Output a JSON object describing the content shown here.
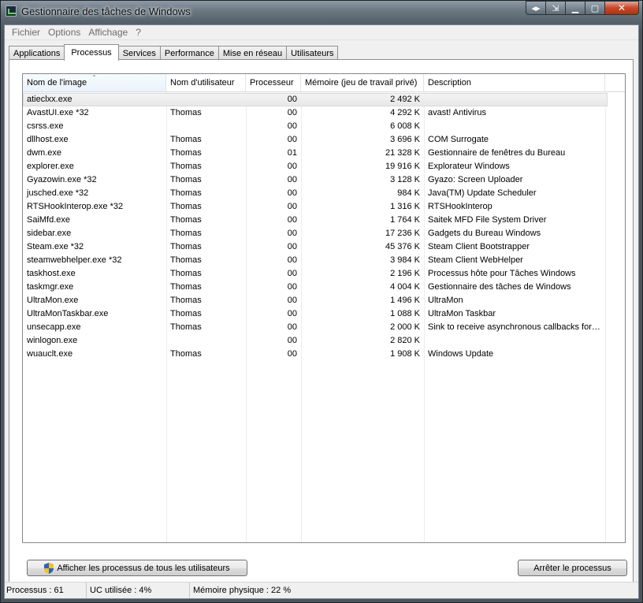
{
  "window": {
    "title": "Gestionnaire des tâches de Windows"
  },
  "menu": [
    "Fichier",
    "Options",
    "Affichage",
    "?"
  ],
  "tabs": [
    {
      "label": "Applications",
      "active": false
    },
    {
      "label": "Processus",
      "active": true
    },
    {
      "label": "Services",
      "active": false
    },
    {
      "label": "Performance",
      "active": false
    },
    {
      "label": "Mise en réseau",
      "active": false
    },
    {
      "label": "Utilisateurs",
      "active": false
    }
  ],
  "columns": [
    "Nom de l'image",
    "Nom d'utilisateur",
    "Processeur",
    "Mémoire (jeu de travail privé)",
    "Description"
  ],
  "processes": [
    {
      "name": "atieclxx.exe",
      "user": "",
      "cpu": "00",
      "mem": "2 492 K",
      "desc": ""
    },
    {
      "name": "AvastUI.exe *32",
      "user": "Thomas",
      "cpu": "00",
      "mem": "4 292 K",
      "desc": "avast! Antivirus"
    },
    {
      "name": "csrss.exe",
      "user": "",
      "cpu": "00",
      "mem": "6 008 K",
      "desc": ""
    },
    {
      "name": "dllhost.exe",
      "user": "Thomas",
      "cpu": "00",
      "mem": "3 696 K",
      "desc": "COM Surrogate"
    },
    {
      "name": "dwm.exe",
      "user": "Thomas",
      "cpu": "01",
      "mem": "21 328 K",
      "desc": "Gestionnaire de fenêtres du Bureau"
    },
    {
      "name": "explorer.exe",
      "user": "Thomas",
      "cpu": "00",
      "mem": "19 916 K",
      "desc": "Explorateur Windows"
    },
    {
      "name": "Gyazowin.exe *32",
      "user": "Thomas",
      "cpu": "00",
      "mem": "3 128 K",
      "desc": "Gyazo: Screen Uploader"
    },
    {
      "name": "jusched.exe *32",
      "user": "Thomas",
      "cpu": "00",
      "mem": "984 K",
      "desc": "Java(TM) Update Scheduler"
    },
    {
      "name": "RTSHookInterop.exe *32",
      "user": "Thomas",
      "cpu": "00",
      "mem": "1 316 K",
      "desc": "RTSHookInterop"
    },
    {
      "name": "SaiMfd.exe",
      "user": "Thomas",
      "cpu": "00",
      "mem": "1 764 K",
      "desc": "Saitek MFD File System Driver"
    },
    {
      "name": "sidebar.exe",
      "user": "Thomas",
      "cpu": "00",
      "mem": "17 236 K",
      "desc": "Gadgets du Bureau Windows"
    },
    {
      "name": "Steam.exe *32",
      "user": "Thomas",
      "cpu": "00",
      "mem": "45 376 K",
      "desc": "Steam Client Bootstrapper"
    },
    {
      "name": "steamwebhelper.exe *32",
      "user": "Thomas",
      "cpu": "00",
      "mem": "3 984 K",
      "desc": "Steam Client WebHelper"
    },
    {
      "name": "taskhost.exe",
      "user": "Thomas",
      "cpu": "00",
      "mem": "2 196 K",
      "desc": "Processus hôte pour Tâches Windows"
    },
    {
      "name": "taskmgr.exe",
      "user": "Thomas",
      "cpu": "00",
      "mem": "4 004 K",
      "desc": "Gestionnaire des tâches de Windows"
    },
    {
      "name": "UltraMon.exe",
      "user": "Thomas",
      "cpu": "00",
      "mem": "1 496 K",
      "desc": "UltraMon"
    },
    {
      "name": "UltraMonTaskbar.exe",
      "user": "Thomas",
      "cpu": "00",
      "mem": "1 088 K",
      "desc": "UltraMon Taskbar"
    },
    {
      "name": "unsecapp.exe",
      "user": "Thomas",
      "cpu": "00",
      "mem": "2 000 K",
      "desc": "Sink to receive asynchronous callbacks for…"
    },
    {
      "name": "winlogon.exe",
      "user": "",
      "cpu": "00",
      "mem": "2 820 K",
      "desc": ""
    },
    {
      "name": "wuauclt.exe",
      "user": "Thomas",
      "cpu": "00",
      "mem": "1 908 K",
      "desc": "Windows Update"
    }
  ],
  "buttons": {
    "show_all": "Afficher les processus de tous les utilisateurs",
    "end_process": "Arrêter le processus"
  },
  "status": {
    "processes": "Processus : 61",
    "cpu": "UC utilisée : 4%",
    "memory": "Mémoire physique : 22 %"
  },
  "icons": {
    "app": "task-manager-icon",
    "shield": "uac-shield-icon"
  }
}
